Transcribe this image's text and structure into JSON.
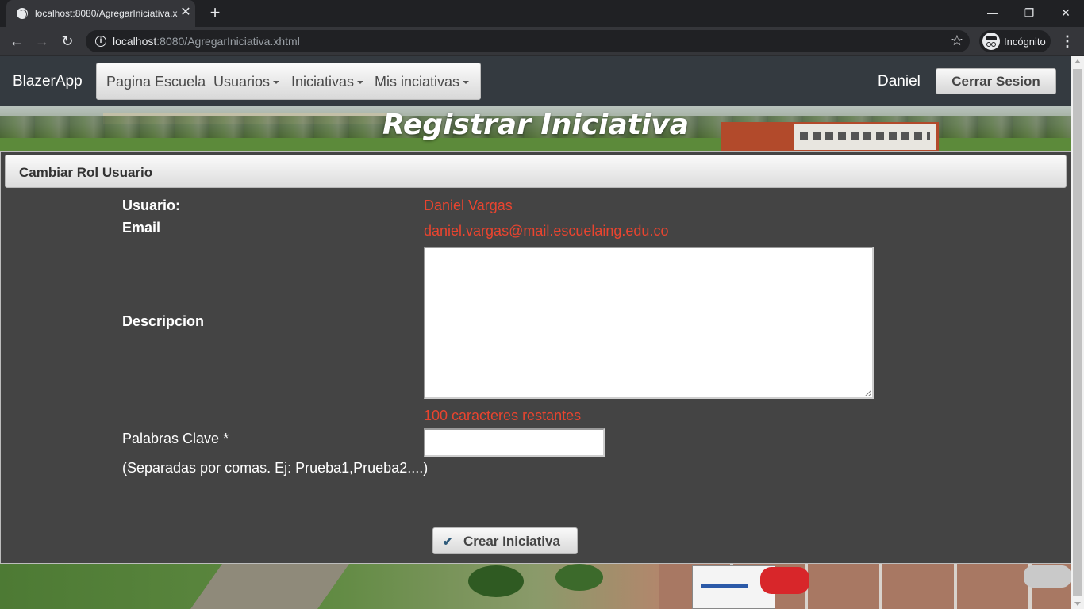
{
  "browser": {
    "tab_title": "localhost:8080/AgregarIniciativa.x",
    "url_host": "localhost",
    "url_rest": ":8080/AgregarIniciativa.xhtml",
    "incognito_label": "Incógnito"
  },
  "app": {
    "brand": "BlazerApp",
    "nav": [
      {
        "label": "Pagina Escuela",
        "dropdown": false
      },
      {
        "label": "Usuarios",
        "dropdown": true
      },
      {
        "label": "Iniciativas",
        "dropdown": true
      },
      {
        "label": "Mis inciativas",
        "dropdown": true
      }
    ],
    "user_name": "Daniel",
    "logout_label": "Cerrar Sesion"
  },
  "banner": {
    "title": "Registrar Iniciativa"
  },
  "panel": {
    "header": "Cambiar Rol Usuario",
    "usuario_label": "Usuario:",
    "usuario_value": "Daniel Vargas",
    "email_label": "Email",
    "email_value": "daniel.vargas@mail.escuelaing.edu.co",
    "descripcion_label": "Descripcion",
    "descripcion_value": "",
    "chars_remaining": "100 caracteres restantes",
    "keywords_label": "Palabras Clave  *",
    "keywords_hint": "(Separadas por comas. Ej: Prueba1,Prueba2....)",
    "keywords_value": "",
    "submit_label": "Crear Iniciativa"
  },
  "colors": {
    "accent_red": "#e9442f",
    "navbar_bg": "#343a40",
    "panel_bg": "#444444"
  }
}
